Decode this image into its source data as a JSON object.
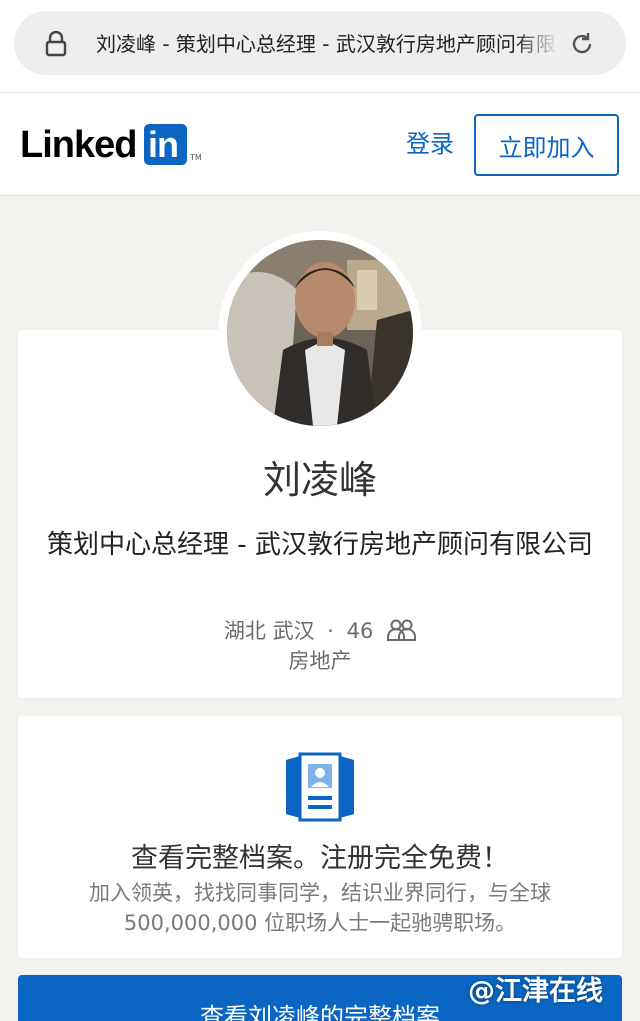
{
  "browser": {
    "url_text": "刘凌峰 - 策划中心总经理 - 武汉敦行房地产顾问有限公司",
    "lock_icon": "lock-icon",
    "reload_icon": "reload-icon"
  },
  "header": {
    "logo_text": "Linked",
    "logo_box_text": "in",
    "logo_tm": "TM",
    "signin_label": "登录",
    "join_label": "立即加入",
    "brand_color": "#0a66c2"
  },
  "profile": {
    "name": "刘凌峰",
    "headline": "策划中心总经理 - 武汉敦行房地产顾问有限公司",
    "location": "湖北 武汉",
    "separator": "·",
    "connections": "46",
    "connections_icon": "people-icon",
    "industry": "房地产"
  },
  "cta": {
    "icon": "profile-document-icon",
    "title": "查看完整档案。注册完全免费！",
    "description": "加入领英，找找同事同学，结识业界同行，与全球 500,000,000 位职场人士一起驰骋职场。",
    "button_label": "查看刘凌峰的完整档案"
  },
  "watermark": "@江津在线"
}
